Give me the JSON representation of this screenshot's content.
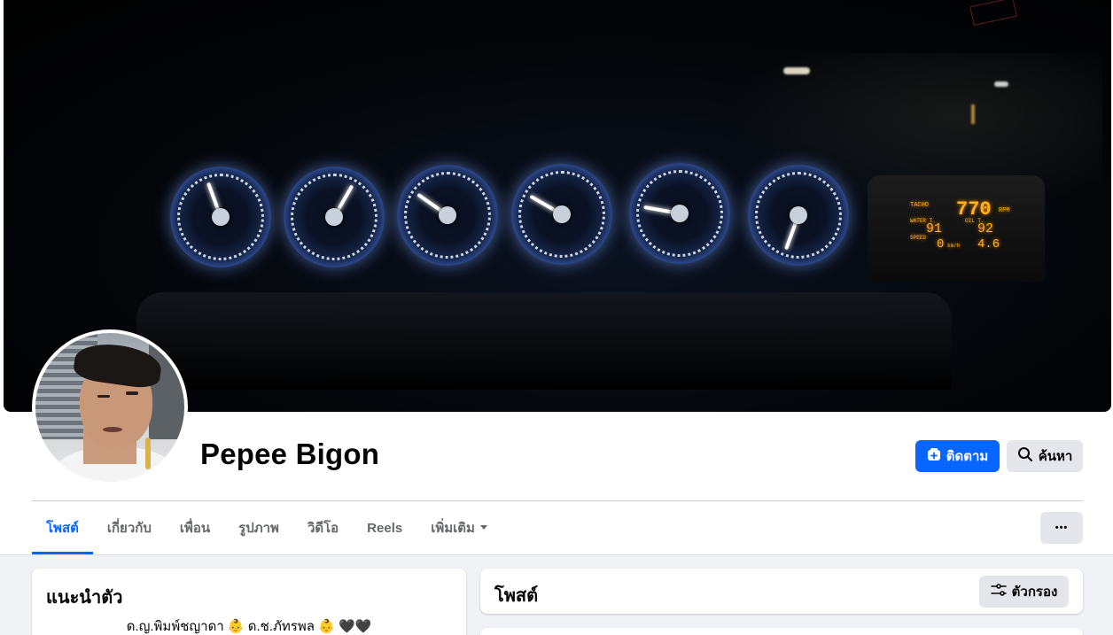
{
  "profile": {
    "name": "Pepee Bigon"
  },
  "actions": {
    "follow_label": "ติดตาม",
    "search_label": "ค้นหา",
    "more_label": "•••"
  },
  "tabs": [
    {
      "label": "โพสต์",
      "active": true
    },
    {
      "label": "เกี่ยวกับ"
    },
    {
      "label": "เพื่อน"
    },
    {
      "label": "รูปภาพ"
    },
    {
      "label": "วิดีโอ"
    },
    {
      "label": "Reels"
    },
    {
      "label": "เพิ่มเติม",
      "dropdown": true
    }
  ],
  "intro": {
    "title": "แนะนำตัว",
    "bio": "ด.ญ.พิมพ์ชญาดา 👶 ด.ช.ภัทรพล 👶 🖤🖤"
  },
  "posts": {
    "title": "โพสต์",
    "filter_label": "ตัวกรอง"
  },
  "cover_display": {
    "tacho_label": "TACHO",
    "rpm": "770",
    "rpm_unit": "RPM",
    "water_label": "WATER T.",
    "water_temp": "91",
    "oil_label": "OIL T.",
    "oil_temp": "92",
    "speed_label": "SPEED",
    "speed": "0",
    "speed_unit": "km/h",
    "oil_pressure": "4.6"
  },
  "colors": {
    "accent": "#0866ff",
    "secondary_button": "#e4e6eb",
    "page_bg": "#f0f2f5"
  },
  "icons": {
    "follow": "person-add-icon",
    "search": "search-icon",
    "filter": "filter-icon",
    "dropdown": "caret-down-icon"
  }
}
